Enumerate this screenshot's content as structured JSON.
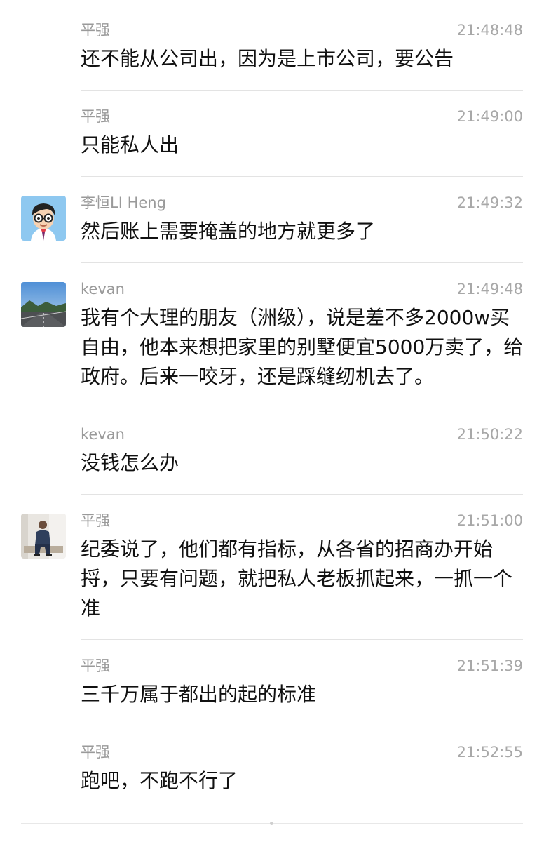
{
  "messages": [
    {
      "sender": "平强",
      "time": "21:48:48",
      "text": "还不能从公司出，因为是上市公司，要公告",
      "avatar": ""
    },
    {
      "sender": "平强",
      "time": "21:49:00",
      "text": "只能私人出",
      "avatar": ""
    },
    {
      "sender": "李恒LI Heng",
      "time": "21:49:32",
      "text": "然后账上需要掩盖的地方就更多了",
      "avatar": "cartoon-glasses-man-avatar"
    },
    {
      "sender": "kevan",
      "time": "21:49:48",
      "text": "我有个大理的朋友（洲级），说是差不多2000w买自由，他本来想把家里的别墅便宜5000万卖了，给政府。后来一咬牙，还是踩缝纫机去了。",
      "avatar": "highway-landscape-avatar"
    },
    {
      "sender": "kevan",
      "time": "21:50:22",
      "text": "没钱怎么办",
      "avatar": ""
    },
    {
      "sender": "平强",
      "time": "21:51:00",
      "text": "纪委说了，他们都有指标，从各省的招商办开始捋，只要有问题，就把私人老板抓起来，一抓一个准",
      "avatar": "seated-man-photo-avatar"
    },
    {
      "sender": "平强",
      "time": "21:51:39",
      "text": "三千万属于都出的起的标准",
      "avatar": ""
    },
    {
      "sender": "平强",
      "time": "21:52:55",
      "text": "跑吧，不跑不行了",
      "avatar": ""
    }
  ],
  "colors": {
    "sender": "#9a9a9a",
    "time": "#a8a8a8",
    "text": "#111111",
    "divider": "#e3e3e3",
    "background": "#ffffff"
  }
}
